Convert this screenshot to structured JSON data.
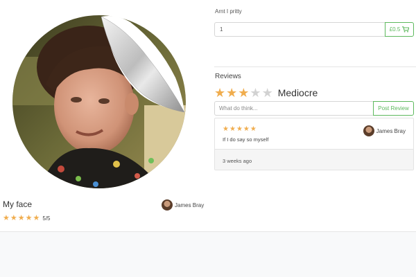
{
  "product": {
    "title": "My face",
    "owner_name": "James Bray",
    "rating_stars": 5,
    "rating_text": "5/5",
    "image_icon": "sticker-photo"
  },
  "item": {
    "name": "Arnt I pritty",
    "quantity_value": "1",
    "price_label": "£0.5",
    "cart_icon": "shopping-cart-icon"
  },
  "reviews": {
    "heading": "Reviews",
    "overall_stars": 3,
    "overall_word": "Mediocre",
    "input_placeholder": "What do think...",
    "post_label": "Post Review",
    "list": [
      {
        "stars": 5,
        "author": "James Bray",
        "text": "If I do say so myself",
        "time": "3 weeks ago"
      }
    ]
  },
  "colors": {
    "star_on": "#f0ad4e",
    "star_off": "#d2d2d2",
    "accent_green": "#5cb85c"
  }
}
